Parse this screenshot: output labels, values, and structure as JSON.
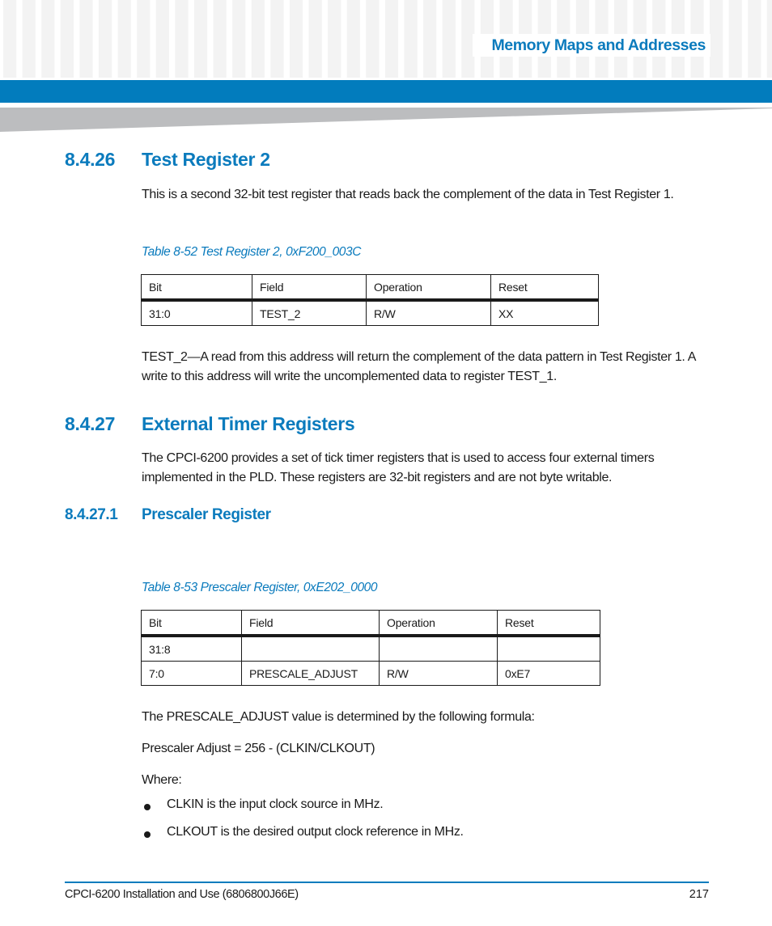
{
  "header": {
    "chapter_title": "Memory Maps and Addresses",
    "accent_color": "#027cbd"
  },
  "sections": {
    "s1": {
      "number": "8.4.26",
      "title": "Test Register 2",
      "intro": " This is a second 32-bit test register that reads back the complement of the data in Test Register 1.",
      "table_caption": "Table 8-52 Test Register 2, 0xF200_003C",
      "table": {
        "headers": [
          "Bit",
          "Field",
          "Operation",
          "Reset"
        ],
        "rows": [
          [
            "31:0",
            "TEST_2",
            "R/W",
            "XX"
          ]
        ]
      },
      "description": "TEST_2—A read from this address will return the complement of the data pattern in Test Register 1. A write to this address will write the uncomplemented data to register TEST_1."
    },
    "s2": {
      "number": "8.4.27",
      "title": "External Timer Registers",
      "intro": "The CPCI-6200 provides a set of tick timer registers that is used to access four external timers implemented in the PLD. These registers are 32-bit registers and are not byte writable."
    },
    "s3": {
      "number": "8.4.27.1",
      "title": "Prescaler Register",
      "table_caption": "Table 8-53 Prescaler Register, 0xE202_0000",
      "table": {
        "headers": [
          "Bit",
          "Field",
          "Operation",
          "Reset"
        ],
        "rows": [
          [
            "31:8",
            "",
            "",
            ""
          ],
          [
            "7:0",
            "PRESCALE_ADJUST",
            "R/W",
            "0xE7"
          ]
        ]
      },
      "formula_intro": "The PRESCALE_ADJUST value is determined by the following formula:",
      "formula": "Prescaler Adjust = 256 - (CLKIN/CLKOUT)",
      "where": "Where:",
      "bullets": [
        "CLKIN is the input clock source in MHz.",
        "CLKOUT is the desired output clock reference in MHz."
      ]
    }
  },
  "footer": {
    "document": "CPCI-6200 Installation and Use (6806800J66E)",
    "page_number": "217"
  }
}
